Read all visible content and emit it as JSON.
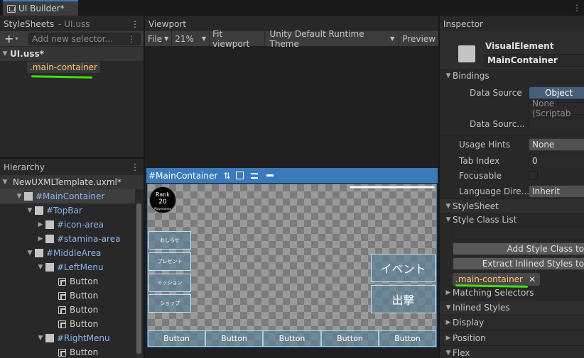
{
  "window": {
    "tab_title": "UI Builder*"
  },
  "stylesheets": {
    "title": "StyleSheets",
    "subtitle": "- UI.uss",
    "add_selector_placeholder": "Add new selector...",
    "sheet_name": "UI.uss*",
    "selector": ".main-container"
  },
  "hierarchy": {
    "title": "Hierarchy",
    "root": "NewUXMLTemplate.uxml*",
    "items": [
      {
        "label": "#MainContainer",
        "type": "element"
      },
      {
        "label": "#TopBar",
        "type": "element"
      },
      {
        "label": "#icon-area",
        "type": "element"
      },
      {
        "label": "#stamina-area",
        "type": "element"
      },
      {
        "label": "#MiddleArea",
        "type": "element"
      },
      {
        "label": "#LeftMenu",
        "type": "element"
      },
      {
        "label": "Button",
        "type": "button"
      },
      {
        "label": "Button",
        "type": "button"
      },
      {
        "label": "Button",
        "type": "button"
      },
      {
        "label": "Button",
        "type": "button"
      },
      {
        "label": "#RightMenu",
        "type": "element"
      },
      {
        "label": "Button",
        "type": "button"
      }
    ]
  },
  "viewport": {
    "title": "Viewport",
    "file_menu": "File",
    "zoom": "21%",
    "fit_label": "Fit viewport",
    "theme": "Unity Default Runtime Theme",
    "preview_label": "Preview",
    "canvas_label": "#MainContainer",
    "rank_label": "Rank",
    "rank_value": "20",
    "rank_sub": "Playername",
    "left_buttons": [
      "おしらせ",
      "プレゼント",
      "ミッション",
      "ショップ"
    ],
    "right_buttons": [
      "イベント",
      "出撃"
    ],
    "bottom_buttons": [
      "Button",
      "Button",
      "Button",
      "Button",
      "Button"
    ]
  },
  "inspector": {
    "title": "Inspector",
    "element_type": "VisualElement",
    "element_name": "MainContainer",
    "bindings_header": "Bindings",
    "data_source_label": "Data Source",
    "data_source_value": "Object",
    "data_source_none": "None (Scriptab",
    "data_source_path_label": "Data Sourc...",
    "usage_hints_label": "Usage Hints",
    "usage_hints_value": "None",
    "tab_index_label": "Tab Index",
    "tab_index_value": "0",
    "focusable_label": "Focusable",
    "language_label": "Language Dire...",
    "language_value": "Inherit",
    "stylesheet_header": "StyleSheet",
    "style_class_list_label": "Style Class List",
    "add_style_class_button": "Add Style Class to",
    "extract_button": "Extract Inlined Styles to",
    "class_chip": ".main-container",
    "matching_selectors": "Matching Selectors",
    "inlined_styles": "Inlined Styles",
    "display": "Display",
    "position": "Position",
    "flex": "Flex"
  },
  "colors": {
    "accent": "#3a79bb",
    "highlight": "#3ee00f",
    "selector_text": "#ffc66d"
  }
}
